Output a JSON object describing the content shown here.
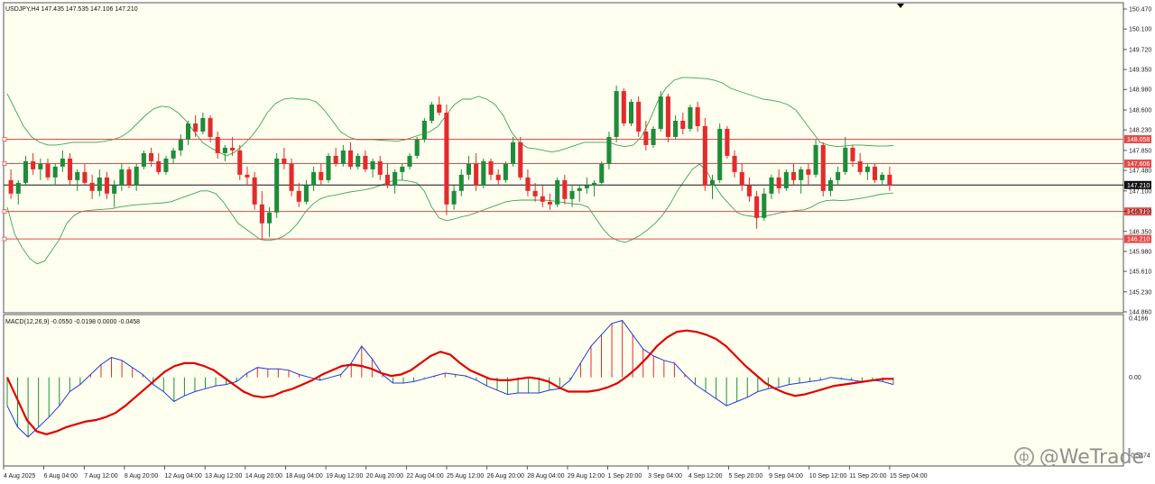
{
  "window": {
    "symbol_header": "USDJPY,H4  147.435 147.535 147.106 147.210",
    "macd_header": "MACD(12,26,9) -0.0550 -0.0198 0.0000 -0.0458"
  },
  "price_axis": {
    "labels": [
      "150.470",
      "150.100",
      "149.720",
      "149.350",
      "148.980",
      "148.600",
      "148.230",
      "147.850",
      "147.480",
      "147.100",
      "146.720",
      "146.350",
      "145.980",
      "145.610",
      "145.230",
      "144.860"
    ]
  },
  "macd_axis": {
    "labels": [
      "0.4166",
      "0.00",
      "-0.5474"
    ]
  },
  "time_axis": {
    "labels": [
      "4 Aug 2025",
      "6 Aug 04:00",
      "7 Aug 12:00",
      "8 Aug 20:00",
      "12 Aug 04:00",
      "13 Aug 12:00",
      "14 Aug 20:00",
      "18 Aug 04:00",
      "19 Aug 12:00",
      "20 Aug 20:00",
      "22 Aug 04:00",
      "25 Aug 12:00",
      "26 Aug 20:00",
      "28 Aug 04:00",
      "29 Aug 12:00",
      "1 Sep 20:00",
      "3 Sep 04:00",
      "4 Sep 12:00",
      "5 Sep 20:00",
      "9 Sep 04:00",
      "10 Sep 12:00",
      "11 Sep 20:00",
      "15 Sep 04:00"
    ]
  },
  "levels": [
    {
      "label": "148.058",
      "price": 148.058
    },
    {
      "label": "147.606",
      "price": 147.606
    },
    {
      "label": "146.719",
      "price": 146.719
    },
    {
      "label": "146.210",
      "price": 146.21
    }
  ],
  "current": {
    "label": "147.210",
    "price": 147.21
  },
  "colors": {
    "bull": "#1e8c3a",
    "bear": "#e32b2b",
    "band": "#3aa655",
    "level": "#e84a4a",
    "macd_main": "#e10000",
    "macd_signal": "#1f3bd8",
    "bg": "#fffff0"
  },
  "watermark": {
    "text": "@WeTrade",
    "icon": "wetrade-logo-icon"
  },
  "chart_data": {
    "type": "candlestick",
    "symbol": "USDJPY",
    "timeframe": "H4",
    "ylim": [
      144.86,
      150.47
    ],
    "bars": [
      [
        147.3,
        147.5,
        146.95,
        147.05
      ],
      [
        147.05,
        147.3,
        146.85,
        147.25
      ],
      [
        147.25,
        147.75,
        147.2,
        147.65
      ],
      [
        147.65,
        147.8,
        147.4,
        147.5
      ],
      [
        147.5,
        147.7,
        147.3,
        147.6
      ],
      [
        147.6,
        147.7,
        147.3,
        147.35
      ],
      [
        147.35,
        147.6,
        147.2,
        147.55
      ],
      [
        147.55,
        147.85,
        147.45,
        147.7
      ],
      [
        147.7,
        147.8,
        147.2,
        147.3
      ],
      [
        147.3,
        147.5,
        147.1,
        147.45
      ],
      [
        147.45,
        147.6,
        147.2,
        147.25
      ],
      [
        147.25,
        147.4,
        146.95,
        147.1
      ],
      [
        147.1,
        147.5,
        147.0,
        147.35
      ],
      [
        147.35,
        147.45,
        146.95,
        147.05
      ],
      [
        147.05,
        147.3,
        146.8,
        147.2
      ],
      [
        147.2,
        147.6,
        147.1,
        147.5
      ],
      [
        147.5,
        147.55,
        147.15,
        147.2
      ],
      [
        147.2,
        147.6,
        147.1,
        147.55
      ],
      [
        147.55,
        147.85,
        147.5,
        147.8
      ],
      [
        147.8,
        147.9,
        147.55,
        147.65
      ],
      [
        147.65,
        147.8,
        147.4,
        147.45
      ],
      [
        147.45,
        147.75,
        147.4,
        147.7
      ],
      [
        147.7,
        147.9,
        147.6,
        147.85
      ],
      [
        147.85,
        148.15,
        147.75,
        148.05
      ],
      [
        148.05,
        148.4,
        147.95,
        148.35
      ],
      [
        148.35,
        148.5,
        148.1,
        148.2
      ],
      [
        148.2,
        148.55,
        148.15,
        148.45
      ],
      [
        148.45,
        148.5,
        148.0,
        148.1
      ],
      [
        148.1,
        148.2,
        147.7,
        147.8
      ],
      [
        147.8,
        147.95,
        147.65,
        147.9
      ],
      [
        147.9,
        148.1,
        147.75,
        147.85
      ],
      [
        147.85,
        147.95,
        147.3,
        147.4
      ],
      [
        147.4,
        147.55,
        147.2,
        147.35
      ],
      [
        147.35,
        147.45,
        146.75,
        146.85
      ],
      [
        146.85,
        147.1,
        146.2,
        146.5
      ],
      [
        146.5,
        146.8,
        146.25,
        146.7
      ],
      [
        146.7,
        147.8,
        146.6,
        147.7
      ],
      [
        147.7,
        147.9,
        147.5,
        147.6
      ],
      [
        147.6,
        147.7,
        147.0,
        147.1
      ],
      [
        147.1,
        147.25,
        146.8,
        146.9
      ],
      [
        146.9,
        147.3,
        146.85,
        147.2
      ],
      [
        147.2,
        147.55,
        147.1,
        147.45
      ],
      [
        147.45,
        147.6,
        147.2,
        147.3
      ],
      [
        147.3,
        147.8,
        147.25,
        147.75
      ],
      [
        147.75,
        147.9,
        147.55,
        147.6
      ],
      [
        147.6,
        147.95,
        147.55,
        147.85
      ],
      [
        147.85,
        148.0,
        147.5,
        147.55
      ],
      [
        147.55,
        147.8,
        147.5,
        147.75
      ],
      [
        147.75,
        147.85,
        147.45,
        147.5
      ],
      [
        147.5,
        147.7,
        147.35,
        147.65
      ],
      [
        147.65,
        147.75,
        147.3,
        147.4
      ],
      [
        147.4,
        147.6,
        147.15,
        147.2
      ],
      [
        147.2,
        147.5,
        147.05,
        147.45
      ],
      [
        147.45,
        147.6,
        147.3,
        147.55
      ],
      [
        147.55,
        147.8,
        147.5,
        147.75
      ],
      [
        147.75,
        148.1,
        147.7,
        148.05
      ],
      [
        148.05,
        148.45,
        148.0,
        148.4
      ],
      [
        148.4,
        148.75,
        148.35,
        148.7
      ],
      [
        148.7,
        148.85,
        148.5,
        148.55
      ],
      [
        148.55,
        148.7,
        146.65,
        146.85
      ],
      [
        146.85,
        147.2,
        146.75,
        147.1
      ],
      [
        147.1,
        147.5,
        147.0,
        147.4
      ],
      [
        147.4,
        147.75,
        147.3,
        147.6
      ],
      [
        147.6,
        147.8,
        147.1,
        147.2
      ],
      [
        147.2,
        147.7,
        147.15,
        147.65
      ],
      [
        147.65,
        147.7,
        147.3,
        147.4
      ],
      [
        147.4,
        147.5,
        147.2,
        147.3
      ],
      [
        147.3,
        147.65,
        147.25,
        147.6
      ],
      [
        147.6,
        148.1,
        147.55,
        148.0
      ],
      [
        148.0,
        148.1,
        147.3,
        147.35
      ],
      [
        147.35,
        147.5,
        147.0,
        147.1
      ],
      [
        147.1,
        147.25,
        146.9,
        147.0
      ],
      [
        147.0,
        147.2,
        146.8,
        146.9
      ],
      [
        146.9,
        147.05,
        146.75,
        146.85
      ],
      [
        146.85,
        147.35,
        146.8,
        147.3
      ],
      [
        147.3,
        147.4,
        146.85,
        146.95
      ],
      [
        146.95,
        147.2,
        146.8,
        147.1
      ],
      [
        147.1,
        147.2,
        146.9,
        147.15
      ],
      [
        147.15,
        147.35,
        147.05,
        147.2
      ],
      [
        147.2,
        147.3,
        147.0,
        147.25
      ],
      [
        147.25,
        147.65,
        147.2,
        147.6
      ],
      [
        147.6,
        148.2,
        147.5,
        148.1
      ],
      [
        148.1,
        149.05,
        148.0,
        148.95
      ],
      [
        148.95,
        149.0,
        148.3,
        148.35
      ],
      [
        148.35,
        148.8,
        148.3,
        148.75
      ],
      [
        148.75,
        148.85,
        148.1,
        148.2
      ],
      [
        148.2,
        148.4,
        147.85,
        147.95
      ],
      [
        147.95,
        148.3,
        147.9,
        148.25
      ],
      [
        148.25,
        148.95,
        148.2,
        148.85
      ],
      [
        148.85,
        148.9,
        148.0,
        148.1
      ],
      [
        148.1,
        148.5,
        148.05,
        148.4
      ],
      [
        148.4,
        148.55,
        148.15,
        148.25
      ],
      [
        148.25,
        148.7,
        148.2,
        148.65
      ],
      [
        148.65,
        148.75,
        148.2,
        148.3
      ],
      [
        148.3,
        148.45,
        147.1,
        147.2
      ],
      [
        147.2,
        147.4,
        146.95,
        147.3
      ],
      [
        147.3,
        148.35,
        147.25,
        148.25
      ],
      [
        148.25,
        148.3,
        147.7,
        147.75
      ],
      [
        147.75,
        147.85,
        147.35,
        147.45
      ],
      [
        147.45,
        147.6,
        147.1,
        147.2
      ],
      [
        147.2,
        147.35,
        146.9,
        147.0
      ],
      [
        147.0,
        147.1,
        146.4,
        146.6
      ],
      [
        146.6,
        147.15,
        146.55,
        147.05
      ],
      [
        147.05,
        147.4,
        146.95,
        147.35
      ],
      [
        147.35,
        147.5,
        147.05,
        147.15
      ],
      [
        147.15,
        147.5,
        147.1,
        147.45
      ],
      [
        147.45,
        147.6,
        147.2,
        147.3
      ],
      [
        147.3,
        147.55,
        147.05,
        147.5
      ],
      [
        147.5,
        147.6,
        147.2,
        147.4
      ],
      [
        147.4,
        148.05,
        147.35,
        147.95
      ],
      [
        147.95,
        148.0,
        147.0,
        147.1
      ],
      [
        147.1,
        147.35,
        147.0,
        147.3
      ],
      [
        147.3,
        147.55,
        147.2,
        147.45
      ],
      [
        147.45,
        148.1,
        147.4,
        147.9
      ],
      [
        147.9,
        147.95,
        147.55,
        147.65
      ],
      [
        147.65,
        147.8,
        147.4,
        147.45
      ],
      [
        147.45,
        147.6,
        147.3,
        147.55
      ],
      [
        147.55,
        147.6,
        147.25,
        147.3
      ],
      [
        147.3,
        147.45,
        147.2,
        147.4
      ],
      [
        147.4,
        147.55,
        147.1,
        147.21
      ]
    ],
    "bollinger_upper": [
      148.9,
      148.6,
      148.3,
      148.1,
      148.0,
      147.95,
      147.95,
      147.97,
      148.0,
      148.0,
      148.0,
      148.0,
      148.02,
      148.05,
      148.1,
      148.2,
      148.35,
      148.5,
      148.62,
      148.67,
      148.65,
      148.55,
      148.4,
      148.2,
      148.0,
      147.9,
      147.82,
      147.75,
      147.82,
      147.95,
      148.1,
      148.3,
      148.55,
      148.72,
      148.8,
      148.82,
      148.8,
      148.8,
      148.75,
      148.6,
      148.4,
      148.2,
      148.1,
      148.05,
      148.05,
      148.05,
      148.04,
      148.03,
      148.02,
      148.05,
      148.1,
      148.15,
      148.2,
      148.3,
      148.5,
      148.7,
      148.8,
      148.8,
      148.85,
      148.8,
      148.7,
      148.5,
      148.2,
      148.0,
      147.9,
      147.88,
      147.85,
      147.82,
      147.85,
      147.9,
      147.95,
      148.0,
      148.0,
      148.0,
      148.0,
      147.95,
      147.92,
      147.95,
      148.1,
      148.4,
      148.75,
      149.0,
      149.15,
      149.2,
      149.2,
      149.19,
      149.18,
      149.15,
      149.1,
      149.0,
      148.95,
      148.9,
      148.85,
      148.8,
      148.78,
      148.75,
      148.7,
      148.6,
      148.4,
      148.2,
      148.0,
      147.95,
      147.92,
      147.93,
      147.95,
      147.95,
      147.94,
      147.93,
      147.93,
      147.94
    ],
    "bollinger_lower": [
      146.8,
      146.3,
      146.05,
      145.85,
      145.75,
      145.8,
      146.0,
      146.2,
      146.5,
      146.65,
      146.72,
      146.74,
      146.75,
      146.76,
      146.77,
      146.8,
      146.82,
      146.84,
      146.85,
      146.86,
      146.87,
      146.88,
      146.9,
      146.95,
      147.0,
      147.05,
      147.1,
      147.1,
      147.05,
      146.9,
      146.7,
      146.5,
      146.4,
      146.3,
      146.2,
      146.18,
      146.2,
      146.25,
      146.35,
      146.5,
      146.7,
      146.85,
      146.95,
      147.0,
      147.02,
      147.05,
      147.08,
      147.1,
      147.12,
      147.15,
      147.2,
      147.25,
      147.3,
      147.3,
      147.28,
      147.25,
      147.1,
      146.8,
      146.6,
      146.55,
      146.58,
      146.62,
      146.65,
      146.7,
      146.75,
      146.8,
      146.85,
      146.9,
      146.92,
      146.93,
      146.93,
      146.93,
      146.93,
      146.92,
      146.9,
      146.88,
      146.86,
      146.85,
      146.8,
      146.6,
      146.4,
      146.25,
      146.18,
      146.15,
      146.2,
      146.28,
      146.38,
      146.5,
      146.65,
      146.85,
      147.1,
      147.3,
      147.5,
      147.6,
      147.45,
      147.2,
      147.0,
      146.85,
      146.7,
      146.65,
      146.63,
      146.62,
      146.64,
      146.67,
      146.7,
      146.72,
      146.74,
      146.75,
      146.8,
      146.88,
      146.92,
      146.93,
      146.92,
      146.93,
      146.95,
      146.97,
      147.0,
      147.03,
      147.05,
      147.06
    ]
  },
  "macd_data": {
    "ylim": [
      -0.5474,
      0.4166
    ],
    "macd_main": [
      0.0,
      -0.15,
      -0.3,
      -0.38,
      -0.4,
      -0.38,
      -0.35,
      -0.33,
      -0.31,
      -0.3,
      -0.28,
      -0.25,
      -0.2,
      -0.14,
      -0.08,
      -0.02,
      0.04,
      0.08,
      0.1,
      0.1,
      0.08,
      0.05,
      0.0,
      -0.05,
      -0.1,
      -0.13,
      -0.14,
      -0.13,
      -0.1,
      -0.08,
      -0.05,
      -0.02,
      0.02,
      0.05,
      0.08,
      0.09,
      0.08,
      0.06,
      0.03,
      0.01,
      0.02,
      0.05,
      0.1,
      0.15,
      0.18,
      0.16,
      0.1,
      0.05,
      0.02,
      -0.01,
      -0.02,
      -0.02,
      -0.01,
      0.0,
      -0.01,
      -0.03,
      -0.07,
      -0.1,
      -0.1,
      -0.1,
      -0.09,
      -0.07,
      -0.04,
      0.01,
      0.07,
      0.14,
      0.22,
      0.28,
      0.32,
      0.33,
      0.32,
      0.3,
      0.27,
      0.22,
      0.15,
      0.08,
      0.02,
      -0.04,
      -0.08,
      -0.11,
      -0.13,
      -0.12,
      -0.1,
      -0.08,
      -0.06,
      -0.05,
      -0.04,
      -0.03,
      -0.02,
      -0.01,
      -0.01
    ],
    "macd_signal": [
      -0.2,
      -0.35,
      -0.42,
      -0.35,
      -0.28,
      -0.2,
      -0.1,
      -0.05,
      0.02,
      0.09,
      0.14,
      0.12,
      0.07,
      0.02,
      -0.05,
      -0.1,
      -0.17,
      -0.13,
      -0.1,
      -0.08,
      -0.06,
      -0.05,
      -0.03,
      0.03,
      0.07,
      0.06,
      0.06,
      0.05,
      0.02,
      0.0,
      -0.02,
      0.0,
      0.02,
      0.1,
      0.22,
      0.13,
      0.02,
      -0.04,
      -0.04,
      -0.03,
      -0.01,
      0.01,
      0.03,
      0.02,
      0.01,
      -0.02,
      -0.06,
      -0.09,
      -0.12,
      -0.11,
      -0.11,
      -0.11,
      -0.09,
      -0.08,
      -0.02,
      0.1,
      0.22,
      0.3,
      0.38,
      0.4,
      0.3,
      0.2,
      0.15,
      0.12,
      0.1,
      0.02,
      -0.05,
      -0.1,
      -0.15,
      -0.2,
      -0.17,
      -0.14,
      -0.1,
      -0.08,
      -0.07,
      -0.05,
      -0.04,
      -0.03,
      -0.02,
      0.0,
      -0.01,
      -0.02,
      -0.03,
      -0.02,
      -0.03,
      -0.05
    ]
  }
}
